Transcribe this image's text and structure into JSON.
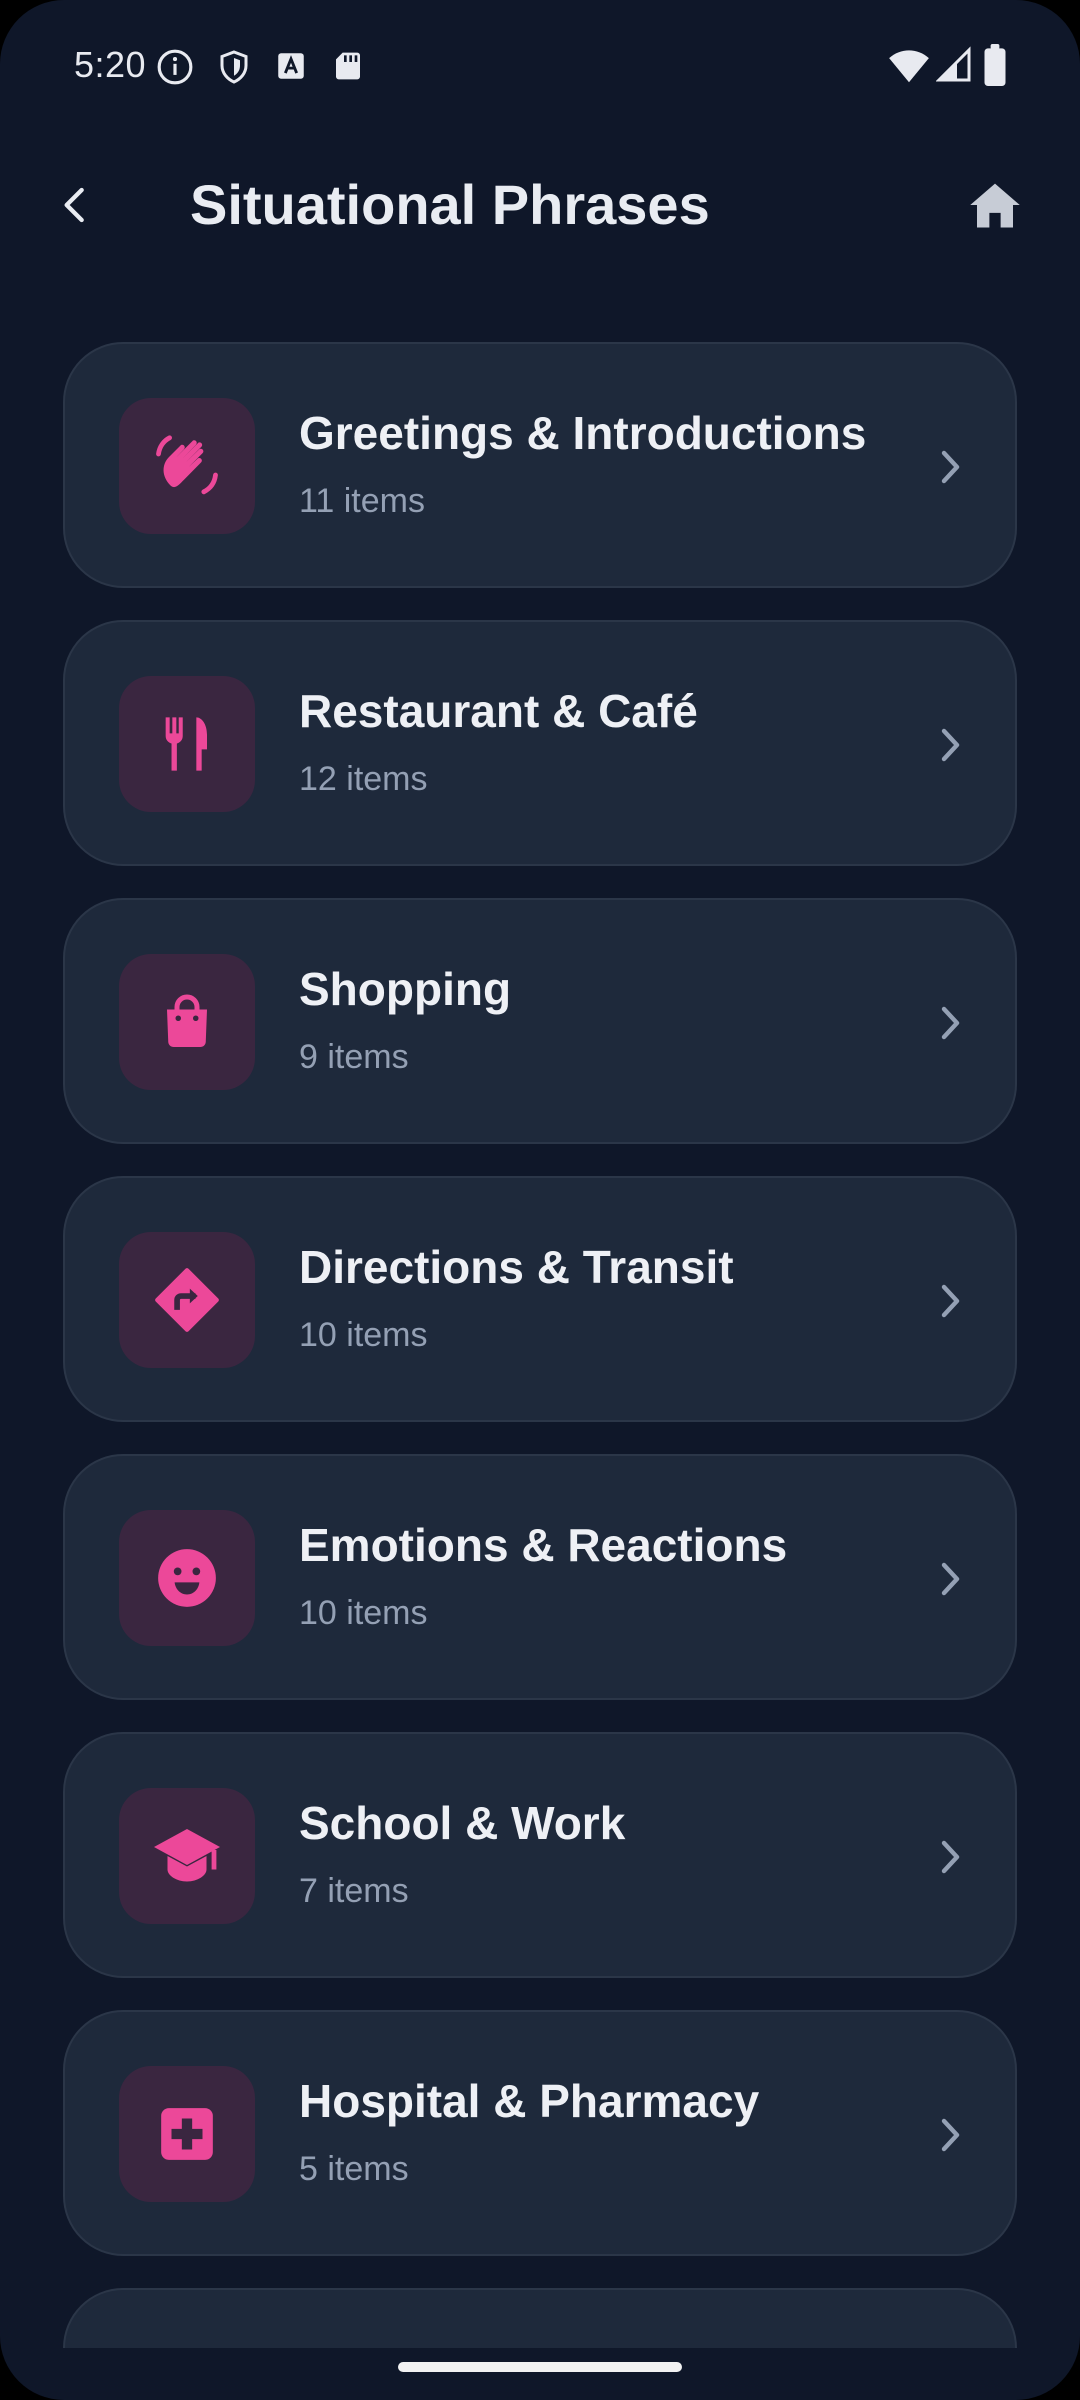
{
  "status_bar": {
    "time": "5:20",
    "left_icons": [
      "info-icon",
      "shield-icon",
      "text-a-icon",
      "sd-card-icon"
    ],
    "right_icons": [
      "wifi-icon",
      "signal-icon",
      "battery-icon"
    ]
  },
  "header": {
    "title": "Situational Phrases",
    "back_icon": "chevron-left-icon",
    "home_icon": "home-icon"
  },
  "colors": {
    "background": "#0f1729",
    "card": "#1e293b",
    "accent": "#ec4899",
    "icon_box": "#3a2640"
  },
  "categories": [
    {
      "title": "Greetings & Introductions",
      "count": "11 items",
      "icon": "waving-hand-icon"
    },
    {
      "title": "Restaurant & Café",
      "count": "12 items",
      "icon": "fork-knife-icon"
    },
    {
      "title": "Shopping",
      "count": "9 items",
      "icon": "shopping-bag-icon"
    },
    {
      "title": "Directions & Transit",
      "count": "10 items",
      "icon": "directions-sign-icon"
    },
    {
      "title": "Emotions & Reactions",
      "count": "10 items",
      "icon": "smiley-icon"
    },
    {
      "title": "School & Work",
      "count": "7 items",
      "icon": "graduation-cap-icon"
    },
    {
      "title": "Hospital & Pharmacy",
      "count": "5 items",
      "icon": "medical-cross-icon"
    }
  ]
}
